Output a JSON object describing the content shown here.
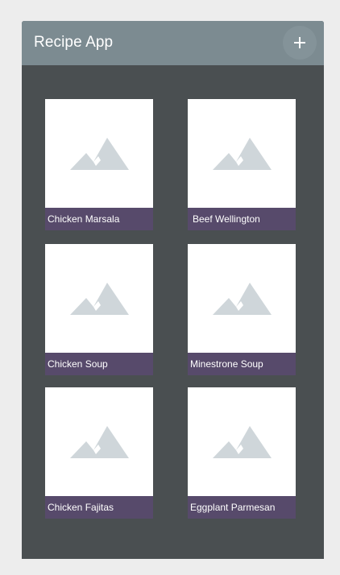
{
  "app": {
    "title": "Recipe App",
    "add_button_icon": "plus-icon"
  },
  "recipes": [
    {
      "name": "Chicken Marsala",
      "image_icon": "image-placeholder-icon"
    },
    {
      "name": "Beef Wellington",
      "image_icon": "image-placeholder-icon"
    },
    {
      "name": "Chicken Soup",
      "image_icon": "image-placeholder-icon"
    },
    {
      "name": "Minestrone Soup",
      "image_icon": "image-placeholder-icon"
    },
    {
      "name": "Chicken Fajitas",
      "image_icon": "image-placeholder-icon"
    },
    {
      "name": "Eggplant Parmesan",
      "image_icon": "image-placeholder-icon"
    }
  ],
  "colors": {
    "app_bar": "#7c8b91",
    "content_background": "#4a4f51",
    "card_label": "#574a6b",
    "placeholder_icon": "#cfd6da"
  }
}
